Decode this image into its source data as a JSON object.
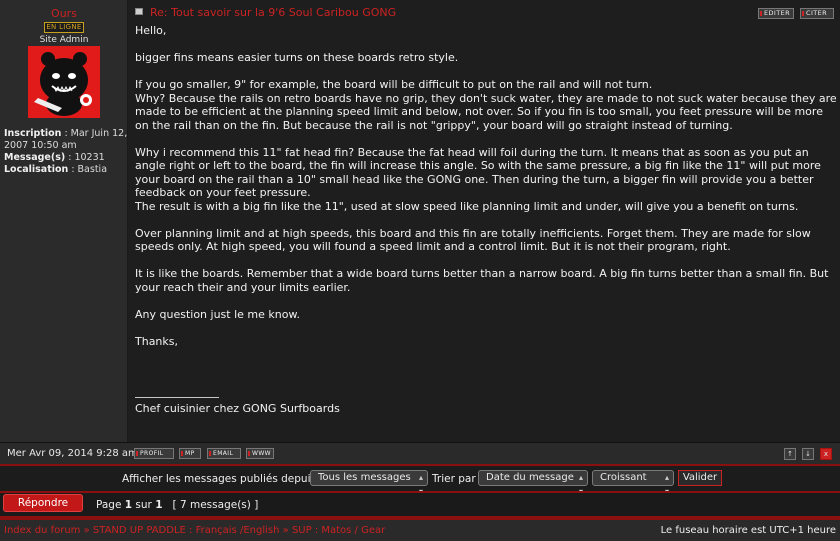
{
  "author": {
    "name": "Ours",
    "status": "EN LIGNE",
    "rank": "Site Admin",
    "info": [
      {
        "label": "Inscription",
        "value": " : Mar Juin 12, 2007 10:50 am"
      },
      {
        "label": "Message(s)",
        "value": " : 10231"
      },
      {
        "label": "Localisation",
        "value": " : Bastia"
      }
    ]
  },
  "post": {
    "title": "Re: Tout savoir sur la 9'6 Soul Caribou GONG",
    "edit_label": "EDITER",
    "quote_label": "CITER",
    "body": [
      "Hello,",
      "bigger fins means easier turns on these boards retro style.",
      "If you go smaller, 9\" for example, the board will be difficult to put on the rail and will not turn.\nWhy? Because the rails on retro boards have no grip, they don't suck water, they are made to not suck water because they are made to be efficient at the planning speed limit and below, not over. So if you fin is too small, you feet pressure will be more on the rail than on the fin. But because the rail is not \"grippy\", your board will go straight instead of turning.",
      "Why i recommend this 11\" fat head fin? Because the fat head will foil during the turn. It means that as soon as you put an angle right or left to the board, the fin will increase this angle. So with the same pressure, a big fin like the 11\" will put more your board on the rail than a 10\" small head like the GONG one. Then during the turn, a bigger fin will provide you a better feedback on your feet pressure.\nThe result is with a big fin like the 11\", used at slow speed like planning limit and under, will give you a benefit on turns.",
      "Over planning limit and at high speeds, this board and this fin are totally inefficients. Forget them. They are made for slow speeds only. At high speed, you will found a speed limit and a control limit. But it is not their program, right.",
      "It is like the boards. Remember that a wide board turns better than a narrow board. A big fin turns better than a small fin. But your reach their and your limits earlier.",
      "Any question just le me know.",
      "Thanks,"
    ],
    "signature": "Chef cuisinier chez GONG Surfboards",
    "date": "Mer Avr 09, 2014 9:28 am",
    "buttons": {
      "profile": "PROFIL",
      "mp": "MP",
      "email": "EMAIL",
      "www": "WWW"
    },
    "nav": {
      "up": "↑",
      "down": "↓",
      "close": "x"
    }
  },
  "filter": {
    "show_label": "Afficher les messages publiés depuis :",
    "messages_value": "Tous les messages",
    "sort_label": "Trier par",
    "sort_value": "Date du message",
    "order_value": "Croissant",
    "validate_label": "Valider"
  },
  "reply": {
    "button_label": "Répondre",
    "page_text": "Page",
    "page_current": "1",
    "page_of": "sur",
    "page_total": "1",
    "count_text": "[ 7 message(s) ]"
  },
  "breadcrumb": {
    "items": [
      "Index du forum",
      "STAND UP PADDLE : Français /English",
      "SUP : Matos / Gear"
    ],
    "separator": "»"
  },
  "timezone": "Le fuseau horaire est UTC+1 heure",
  "colors": {
    "accent": "#cc2222",
    "status_gold": "#d4a020",
    "background": "#1a1a1a"
  }
}
